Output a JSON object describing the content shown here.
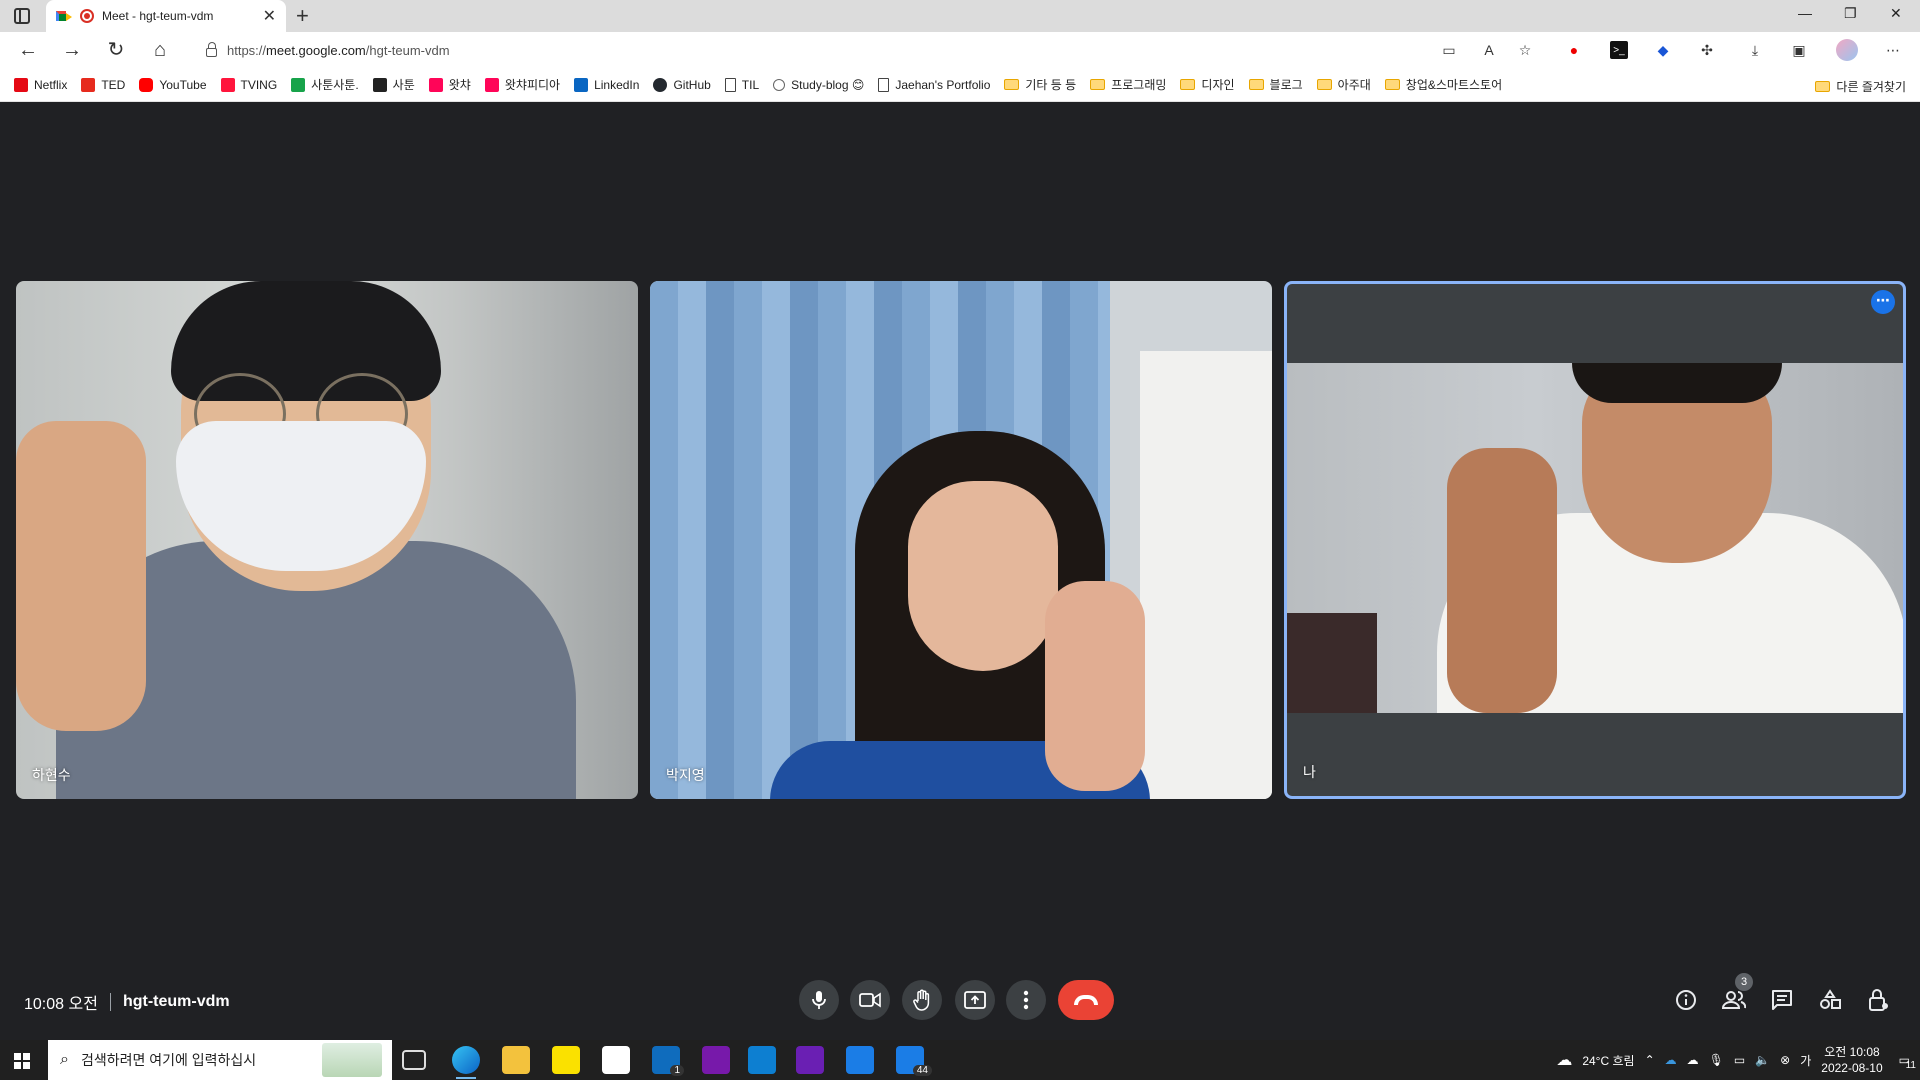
{
  "browser": {
    "tab_title": "Meet - hgt-teum-vdm",
    "url_prefix": "https://",
    "url_domain": "meet.google.com",
    "url_path": "/hgt-teum-vdm"
  },
  "bookmarks": [
    {
      "label": "Netflix",
      "color": "#e50914"
    },
    {
      "label": "TED",
      "color": "#e62b1e"
    },
    {
      "label": "YouTube",
      "color": "#ff0000"
    },
    {
      "label": "TVING",
      "color": "#ff153c"
    },
    {
      "label": "사툰사툰.",
      "color": "#17a34a"
    },
    {
      "label": "사툰",
      "color": "#222222"
    },
    {
      "label": "왓챠",
      "color": "#ff0558"
    },
    {
      "label": "왓챠피디아",
      "color": "#ff0558"
    },
    {
      "label": "LinkedIn",
      "color": "#0a66c2"
    },
    {
      "label": "GitHub",
      "color": "#24292f"
    },
    {
      "label": "TIL",
      "color": "doc"
    },
    {
      "label": "Study-blog 😊",
      "color": "#666666"
    },
    {
      "label": "Jaehan's Portfolio",
      "color": "doc"
    },
    {
      "label": "기타 등 등",
      "color": "folder"
    },
    {
      "label": "프로그래밍",
      "color": "folder"
    },
    {
      "label": "디자인",
      "color": "folder"
    },
    {
      "label": "블로그",
      "color": "folder"
    },
    {
      "label": "아주대",
      "color": "folder"
    },
    {
      "label": "창업&스마트스토어",
      "color": "folder"
    }
  ],
  "bookmarks_other": "다른 즐겨찾기",
  "participants": [
    {
      "name": "하현수"
    },
    {
      "name": "박지영"
    },
    {
      "name": "나"
    }
  ],
  "meeting": {
    "time": "10:08 오전",
    "code": "hgt-teum-vdm",
    "participant_count": "3"
  },
  "taskbar": {
    "search_placeholder": "검색하려면 여기에 입력하십시",
    "weather": "24°C 흐림",
    "clock_time": "오전 10:08",
    "clock_date": "2022-08-10",
    "mail_badge": "1",
    "app_badge": "44",
    "notif_count": "11"
  },
  "colors": {
    "meet_bg": "#202124",
    "end_call": "#ea4335",
    "self_border": "#8ab4f8",
    "accent": "#1a73e8"
  }
}
